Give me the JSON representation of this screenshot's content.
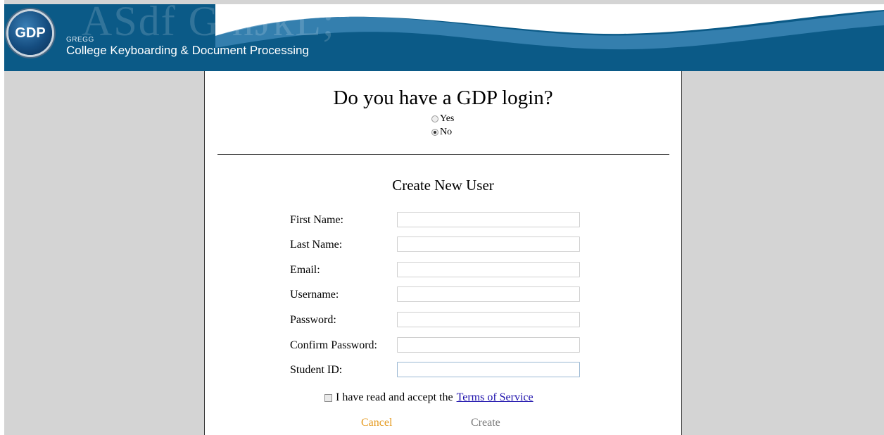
{
  "header": {
    "logo_text": "GDP",
    "brand_small": "GREGG",
    "brand_title": "College Keyboarding & Document Processing",
    "background_letters": "ASdf G hJkL;\"",
    "colors": {
      "header_bg": "#0b5a87",
      "wave": "#3f88b8"
    }
  },
  "login_question": {
    "title": "Do you have a GDP login?",
    "options": [
      {
        "label": "Yes",
        "selected": false
      },
      {
        "label": "No",
        "selected": true
      }
    ]
  },
  "create_user": {
    "title": "Create New User",
    "fields": [
      {
        "label": "First Name:",
        "value": ""
      },
      {
        "label": "Last Name:",
        "value": ""
      },
      {
        "label": "Email:",
        "value": ""
      },
      {
        "label": "Username:",
        "value": ""
      },
      {
        "label": "Password:",
        "value": ""
      },
      {
        "label": "Confirm Password:",
        "value": ""
      },
      {
        "label": "Student ID:",
        "value": ""
      }
    ],
    "tos_text": "I have read and accept the",
    "tos_link": "Terms of Service",
    "cancel_label": "Cancel",
    "create_label": "Create",
    "colors": {
      "cancel": "#e59b21",
      "create": "#7a7a7a",
      "link": "#1a0dab"
    }
  }
}
